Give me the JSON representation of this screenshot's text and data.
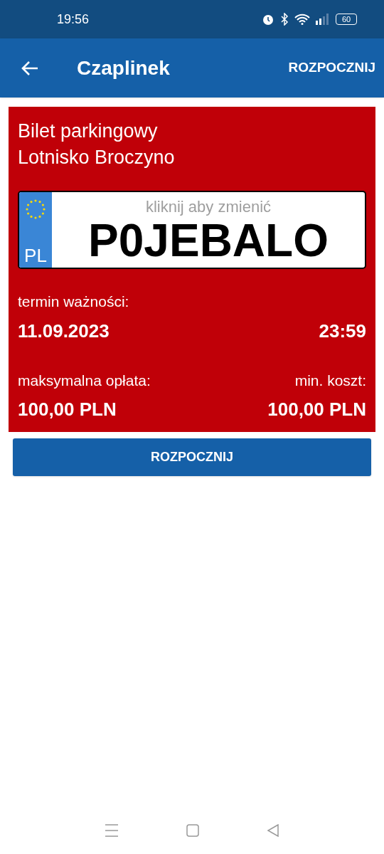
{
  "status_bar": {
    "time": "19:56",
    "battery": "60"
  },
  "app_bar": {
    "title": "Czaplinek",
    "action": "ROZPOCZNIJ"
  },
  "ticket": {
    "title_lines": [
      "Bilet parkingowy",
      "Lotnisko Broczyno"
    ],
    "plate": {
      "country": "PL",
      "hint": "kliknij aby zmienić",
      "number": "P0JEBALO"
    },
    "validity": {
      "label": "termin ważności:",
      "date": "11.09.2023",
      "time": "23:59"
    },
    "fees": [
      {
        "label": "maksymalna opłata:",
        "value": "100,00 PLN"
      },
      {
        "label": "min. koszt:",
        "value": "100,00 PLN"
      }
    ]
  },
  "start_button": "ROZPOCZNIJ"
}
